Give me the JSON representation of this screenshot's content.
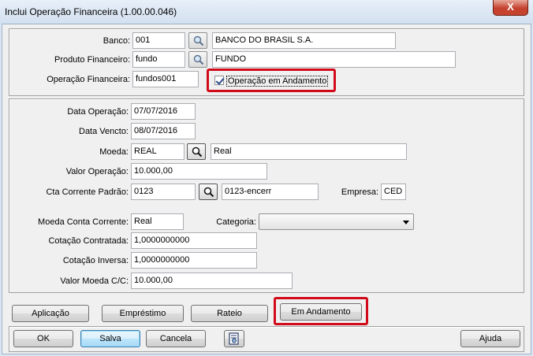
{
  "window": {
    "title": "Inclui Operação Financeira (1.00.00.046)",
    "close_label": "X"
  },
  "top_group": {
    "banco": {
      "label": "Banco:",
      "code": "001",
      "name": "BANCO DO BRASIL S.A."
    },
    "produto": {
      "label": "Produto Financeiro:",
      "code": "fundo",
      "name": "FUNDO"
    },
    "operacao": {
      "label": "Operação Financeira:",
      "code": "fundos001"
    },
    "andamento_checkbox": {
      "label": "Operação em Andamento",
      "checked": true
    }
  },
  "details": {
    "data_operacao": {
      "label": "Data Operação:",
      "value": "07/07/2016"
    },
    "data_vencto": {
      "label": "Data Vencto:",
      "value": "08/07/2016"
    },
    "moeda": {
      "label": "Moeda:",
      "code": "REAL",
      "name": "Real"
    },
    "valor_operacao": {
      "label": "Valor Operação:",
      "value": "10.000,00"
    },
    "cta_corrente": {
      "label": "Cta Corrente Padrão:",
      "code": "0123",
      "name": "0123-encerr"
    },
    "empresa": {
      "label": "Empresa:",
      "value": "CED"
    },
    "moeda_cc": {
      "label": "Moeda Conta Corrente:",
      "value": "Real"
    },
    "categoria": {
      "label": "Categoria:",
      "value": ""
    },
    "cotacao_contratada": {
      "label": "Cotação Contratada:",
      "value": "1,0000000000"
    },
    "cotacao_inversa": {
      "label": "Cotação Inversa:",
      "value": "1,0000000000"
    },
    "valor_moeda_cc": {
      "label": "Valor Moeda C/C:",
      "value": "10.000,00"
    }
  },
  "action_buttons": {
    "aplicacao": "Aplicação",
    "emprestimo": "Empréstimo",
    "rateio": "Rateio",
    "em_andamento": "Em Andamento"
  },
  "footer_buttons": {
    "ok": "OK",
    "salva": "Salva",
    "cancela": "Cancela",
    "ajuda": "Ajuda"
  },
  "icons": {
    "search": "magnifier-icon",
    "report": "report-icon"
  },
  "colors": {
    "highlight": "#d10a1a",
    "titlebar": "#dbe6f3",
    "close": "#c7442f"
  }
}
